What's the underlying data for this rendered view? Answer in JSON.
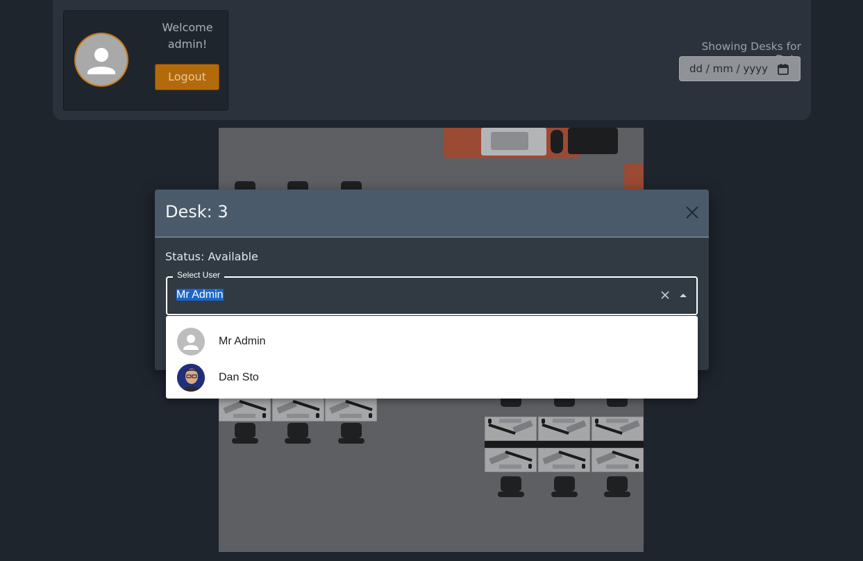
{
  "header": {
    "welcome_text": "Welcome admin!",
    "logout_label": "Logout",
    "date_label": "Showing Desks for Date",
    "date_placeholder": "dd / mm / yyyy"
  },
  "modal": {
    "title": "Desk: 3",
    "status": "Status: Available",
    "select_label": "Select User",
    "selected_value": "Mr Admin"
  },
  "dropdown": {
    "options": [
      {
        "name": "Mr Admin",
        "avatar": "default-avatar-icon"
      },
      {
        "name": "Dan Sto",
        "avatar": "photo-avatar"
      }
    ]
  },
  "colors": {
    "accent": "#b36a0a",
    "selection": "#1a66c9"
  }
}
